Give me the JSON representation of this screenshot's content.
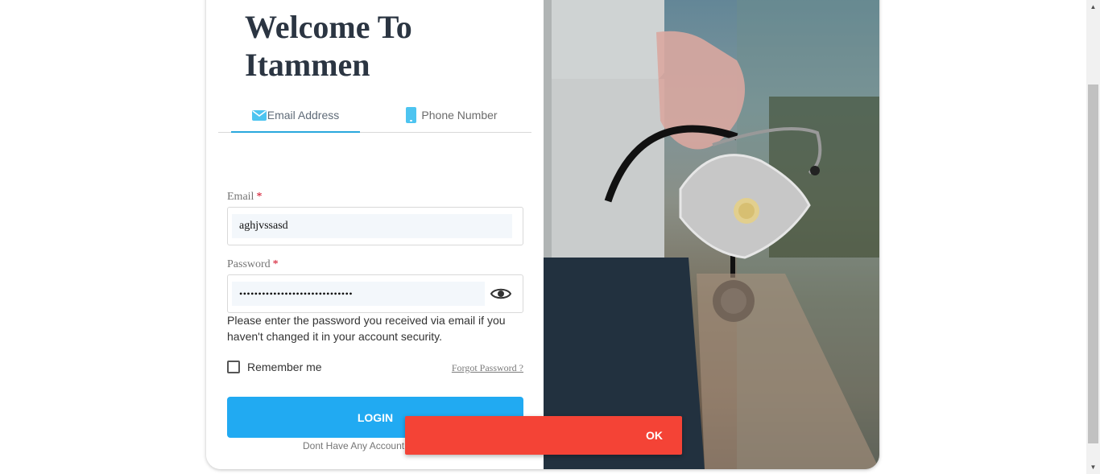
{
  "heading": "Welcome To\nItammen",
  "tabs": [
    {
      "label": "Email Address",
      "icon": "mail-icon",
      "active": true
    },
    {
      "label": "Phone Number",
      "icon": "phone-icon",
      "active": false
    }
  ],
  "form": {
    "email_label": "Email",
    "email_value": "aghjvssasd",
    "password_label": "Password",
    "password_value": "••••••••••••••••••••••••••••••",
    "required_mark": "*",
    "hint": "Please enter the password you received via email if you haven't changed it in your account security.",
    "remember_label": "Remember me",
    "forgot_label": "Forgot Password ?",
    "login_label": "LOGIN",
    "signup_text": "Dont Have Any Account"
  },
  "toast": {
    "button_label": "OK",
    "color": "#f44336"
  },
  "colors": {
    "accent": "#21aaf2",
    "tab_underline": "#29a8dd",
    "icon": "#4dc4f0"
  }
}
